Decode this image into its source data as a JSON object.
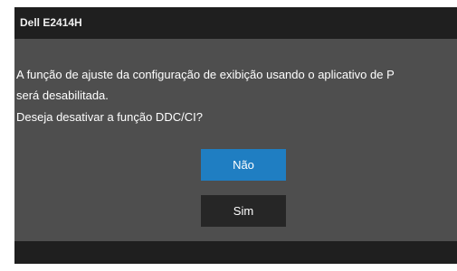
{
  "dialog": {
    "title": "Dell E2414H",
    "message": [
      "A função de ajuste da configuração de exibição usando o aplicativo de P",
      "será desabilitada.",
      "Deseja desativar a função DDC/CI?"
    ],
    "buttons": {
      "no_label": "Não",
      "yes_label": "Sim"
    }
  },
  "colors": {
    "panel": "#4e4e4e",
    "header": "#1f1f1f",
    "selected_button": "#1f7ec2",
    "button": "#262626"
  }
}
